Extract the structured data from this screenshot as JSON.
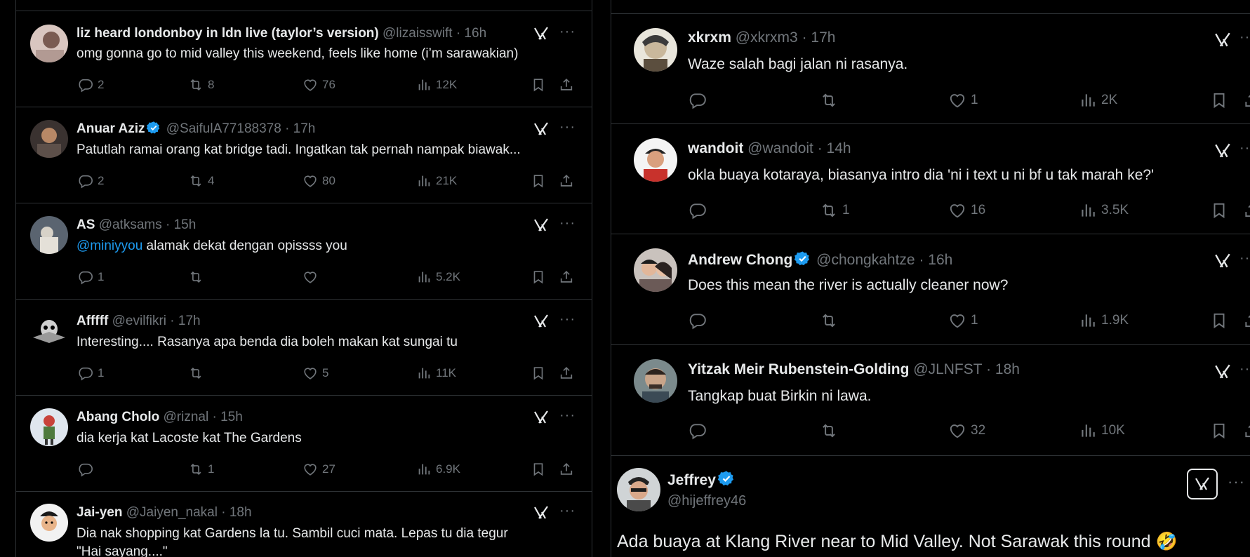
{
  "left_column": {
    "tweets": [
      {
        "name": "liz heard londonboy in ldn live (taylor’s version)",
        "handle": "@lizaisswift",
        "time": "· 16h",
        "text": "omg gonna go to mid valley this weekend, feels like home (i’m sarawakian)",
        "replies": "2",
        "retweets": "8",
        "likes": "76",
        "views": "12K",
        "verified": false
      },
      {
        "name": "Anuar Aziz",
        "handle": "@SaifulA77188378",
        "time": "· 17h",
        "text": "Patutlah ramai orang kat bridge tadi. Ingatkan tak pernah nampak biawak...",
        "replies": "2",
        "retweets": "4",
        "likes": "80",
        "views": "21K",
        "verified": true
      },
      {
        "name": "AS",
        "handle": "@atksams",
        "time": "· 15h",
        "mention": "@miniyyou",
        "text": " alamak dekat dengan opissss you",
        "replies": "1",
        "retweets": "",
        "likes": "",
        "views": "5.2K",
        "verified": false
      },
      {
        "name": "Afffff",
        "handle": "@evilfikri",
        "time": "· 17h",
        "text": "Interesting.... Rasanya apa benda dia boleh makan kat sungai tu",
        "replies": "1",
        "retweets": "",
        "likes": "5",
        "views": "11K",
        "verified": false
      },
      {
        "name": "Abang Cholo",
        "handle": "@riznal",
        "time": "· 15h",
        "text": "dia kerja kat Lacoste kat The Gardens",
        "replies": "",
        "retweets": "1",
        "likes": "27",
        "views": "6.9K",
        "verified": false
      },
      {
        "name": "Jai-yen",
        "handle": "@Jaiyen_nakal",
        "time": "· 18h",
        "text": "Dia nak shopping kat Gardens la tu. Sambil cuci mata. Lepas tu dia tegur",
        "text2": "\"Hai sayang....\"",
        "verified": false
      }
    ]
  },
  "right_column": {
    "tweets": [
      {
        "name": "xkrxm",
        "handle": "@xkrxm3",
        "time": "· 17h",
        "text": "Waze salah bagi jalan ni rasanya.",
        "replies": "",
        "retweets": "",
        "likes": "1",
        "views": "2K",
        "verified": false
      },
      {
        "name": "wandoit",
        "handle": "@wandoit",
        "time": "· 14h",
        "text": "okla buaya kotaraya, biasanya intro dia 'ni i text u ni bf u tak marah ke?'",
        "replies": "",
        "retweets": "1",
        "likes": "16",
        "views": "3.5K",
        "verified": false
      },
      {
        "name": "Andrew Chong",
        "handle": "@chongkahtze",
        "time": "· 16h",
        "text": "Does this mean the river is actually cleaner now?",
        "replies": "",
        "retweets": "",
        "likes": "1",
        "views": "1.9K",
        "verified": true
      },
      {
        "name": "Yitzak Meir Rubenstein-Golding",
        "handle": "@JLNFST",
        "time": "· 18h",
        "text": "Tangkap buat Birkin ni lawa.",
        "replies": "",
        "retweets": "",
        "likes": "32",
        "views": "10K",
        "verified": false
      }
    ],
    "main_tweet": {
      "name": "Jeffrey",
      "handle": "@hijeffrey46",
      "text": "Ada buaya at Klang River near to Mid Valley. Not Sarawak this round 🤣",
      "verified": true
    }
  },
  "icons": {
    "reply": "reply-icon",
    "retweet": "retweet-icon",
    "like": "heart-icon",
    "views": "views-icon",
    "bookmark": "bookmark-icon",
    "share": "share-icon",
    "grok": "grok-icon",
    "more": "more-icon",
    "verified": "verified-badge-icon"
  },
  "colors": {
    "background": "#000000",
    "text": "#e7e9ea",
    "muted": "#71767b",
    "link": "#1d9bf0",
    "verified": "#1d9bf0",
    "divider": "#2f3336"
  },
  "more_glyph": "···"
}
